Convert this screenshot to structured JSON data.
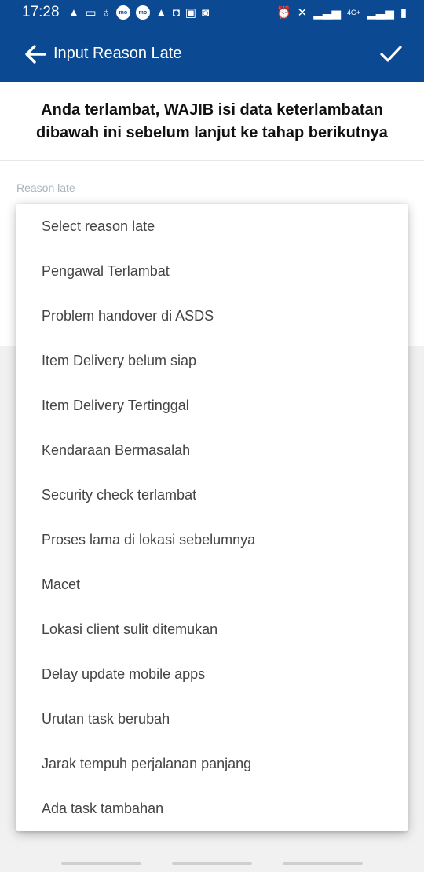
{
  "status_bar": {
    "time": "17:28",
    "pill_1": "mo",
    "pill_2": "mo",
    "network_label": "4G+"
  },
  "app_bar": {
    "title": "Input Reason Late"
  },
  "notice": {
    "text": "Anda terlambat, WAJIB isi data keterlambatan dibawah ini sebelum lanjut ke tahap berikutnya"
  },
  "form": {
    "reason_label": "Reason late"
  },
  "dropdown": {
    "options": [
      "Select reason late",
      "Pengawal Terlambat",
      "Problem handover di ASDS",
      "Item Delivery belum siap",
      "Item Delivery Tertinggal",
      "Kendaraan Bermasalah",
      "Security check terlambat",
      "Proses lama di lokasi sebelumnya",
      "Macet",
      "Lokasi client sulit ditemukan",
      "Delay update mobile apps",
      "Urutan task berubah",
      "Jarak tempuh perjalanan panjang",
      "Ada task tambahan"
    ]
  },
  "colors": {
    "primary": "#0b4a93",
    "label": "#a9b2bb",
    "option_text": "#444444"
  }
}
